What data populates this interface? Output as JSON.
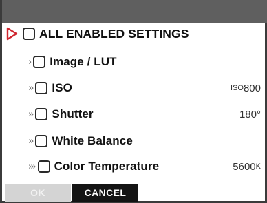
{
  "menu": {
    "items": [
      {
        "indent": "",
        "label": "ALL ENABLED SETTINGS",
        "value": "",
        "value_unit": "",
        "checked": false,
        "selected": true
      },
      {
        "indent": "›",
        "label": "Image / LUT",
        "value": "",
        "value_unit": "",
        "checked": false,
        "selected": false
      },
      {
        "indent": "››",
        "label": "ISO",
        "value": "ISO",
        "value_unit": "800",
        "checked": false,
        "selected": false
      },
      {
        "indent": "››",
        "label": "Shutter",
        "value": "180°",
        "value_unit": "",
        "checked": false,
        "selected": false
      },
      {
        "indent": "››",
        "label": "White Balance",
        "value": "",
        "value_unit": "",
        "checked": false,
        "selected": false
      },
      {
        "indent": "›››",
        "label": "Color Temperature",
        "value": "5600",
        "value_unit": "K",
        "checked": false,
        "selected": false
      }
    ]
  },
  "buttons": {
    "ok_label": "OK",
    "cancel_label": "CANCEL"
  },
  "icons": {
    "selection": "selection-arrow-icon",
    "checkbox": "checkbox-icon"
  },
  "colors": {
    "titlebar": "#5f5f5f",
    "selection_arrow": "#d0262f",
    "ok_button_disabled": "#d4d4d4",
    "cancel_button": "#141414"
  }
}
